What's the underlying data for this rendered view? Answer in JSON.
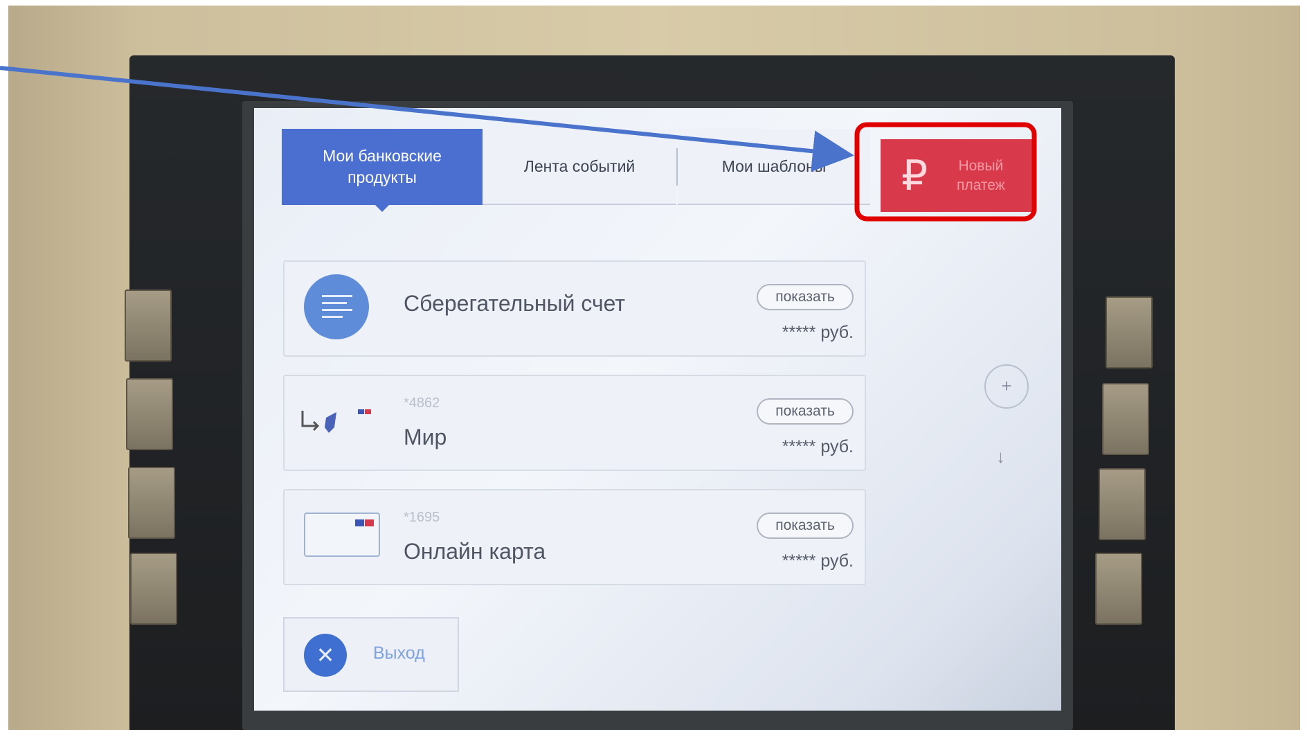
{
  "tabs": [
    {
      "label_line1": "Мои банковские",
      "label_line2": "продукты",
      "active": true
    },
    {
      "label": "Лента событий",
      "active": false
    },
    {
      "label": "Мои шаблоны",
      "active": false
    }
  ],
  "new_payment": {
    "icon": "ruble-icon",
    "symbol": "₽",
    "label_line1": "Новый",
    "label_line2": "платеж"
  },
  "products": [
    {
      "name": "Сберегательный счет",
      "masked_number": "",
      "icon": "savings-account-icon",
      "show_label": "показать",
      "amount": "***** руб."
    },
    {
      "name": "Мир",
      "masked_number": "*4862",
      "icon": "mir-card-icon",
      "show_label": "показать",
      "amount": "***** руб."
    },
    {
      "name": "Онлайн карта",
      "masked_number": "*1695",
      "icon": "online-card-icon",
      "show_label": "показать",
      "amount": "***** руб."
    }
  ],
  "exit": {
    "label": "Выход",
    "icon": "close-icon",
    "symbol": "✕"
  },
  "side": {
    "scroll_down_symbol": "↓",
    "plus_symbol": "+"
  },
  "colors": {
    "accent_blue": "#4a6fd0",
    "payment_red": "#d83a4b",
    "highlight_red": "#e00000",
    "arrow_blue": "#4a74cc"
  }
}
